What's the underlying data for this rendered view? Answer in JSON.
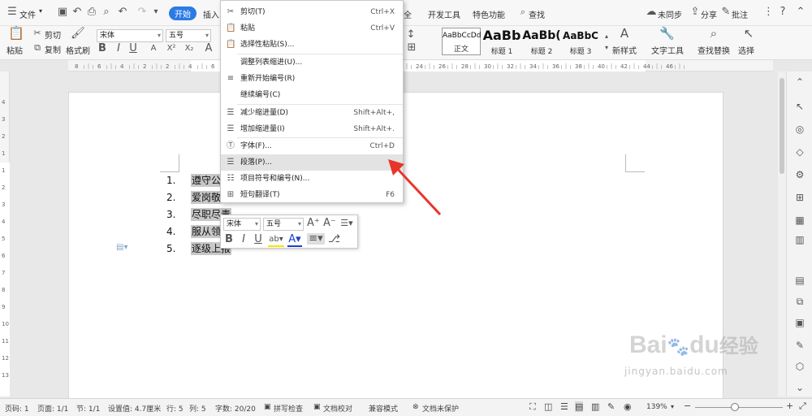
{
  "topbar": {
    "menu_label": "文件",
    "tabs": [
      "开始",
      "插入",
      "全",
      "开发工具",
      "特色功能"
    ],
    "search_label": "查找",
    "sync_label": "未同步",
    "share_label": "分享",
    "comment_label": "批注"
  },
  "ribbon": {
    "paste": "粘贴",
    "cut": "剪切",
    "copy": "复制",
    "format_painter": "格式刷",
    "font_name": "宋体",
    "font_size": "五号",
    "styles": [
      {
        "sample": "AaBbCcDd",
        "name": "正文"
      },
      {
        "sample": "AaBb",
        "name": "标题 1"
      },
      {
        "sample": "AaBb(",
        "name": "标题 2"
      },
      {
        "sample": "AaBbC",
        "name": "标题 3"
      }
    ],
    "new_style": "新样式",
    "text_tools": "文字工具",
    "find_replace": "查找替换",
    "select": "选择"
  },
  "ruler": {
    "h_ticks": [
      "8",
      "6",
      "4",
      "2",
      "2",
      "4",
      "6",
      "8",
      "10",
      "12",
      "14",
      "16",
      "18",
      "20",
      "22",
      "24",
      "26",
      "28",
      "30",
      "32",
      "34",
      "36",
      "38",
      "40",
      "42",
      "44",
      "46"
    ],
    "v_ticks": [
      "4",
      "3",
      "2",
      "1",
      "1",
      "2",
      "3",
      "4",
      "5",
      "6",
      "7",
      "8",
      "9",
      "10",
      "11",
      "12",
      "13"
    ]
  },
  "document": {
    "list": [
      {
        "num": "1.",
        "text": "遵守公"
      },
      {
        "num": "2.",
        "text": "爱岗敬"
      },
      {
        "num": "3.",
        "text": "尽职尽责"
      },
      {
        "num": "4.",
        "text": "服从领"
      },
      {
        "num": "5.",
        "text": "逐级上报"
      }
    ]
  },
  "context_menu": {
    "items": [
      {
        "icon": "✂",
        "label": "剪切(T)",
        "shortcut": "Ctrl+X"
      },
      {
        "icon": "📋",
        "label": "粘贴",
        "shortcut": "Ctrl+V"
      },
      {
        "icon": "📋",
        "label": "选择性粘贴(S)...",
        "shortcut": ""
      },
      {
        "icon": "",
        "label": "调整列表缩进(U)...",
        "shortcut": ""
      },
      {
        "icon": "≡",
        "label": "重新开始编号(R)",
        "shortcut": ""
      },
      {
        "icon": "",
        "label": "继续编号(C)",
        "shortcut": ""
      },
      {
        "icon": "☰",
        "label": "减少缩进量(D)",
        "shortcut": "Shift+Alt+,"
      },
      {
        "icon": "☰",
        "label": "增加缩进量(I)",
        "shortcut": "Shift+Alt+."
      },
      {
        "icon": "Ⓣ",
        "label": "字体(F)...",
        "shortcut": "Ctrl+D"
      },
      {
        "icon": "☰",
        "label": "段落(P)...",
        "shortcut": ""
      },
      {
        "icon": "☷",
        "label": "项目符号和编号(N)...",
        "shortcut": ""
      },
      {
        "icon": "⊞",
        "label": "短句翻译(T)",
        "shortcut": "F6"
      }
    ]
  },
  "minibar": {
    "font_name": "宋体",
    "font_size": "五号"
  },
  "statusbar": {
    "page_num": "页码: 1",
    "pages": "页面: 1/1",
    "section": "节: 1/1",
    "setting": "设置值: 4.7厘米",
    "row": "行: 5",
    "col": "列: 5",
    "word_count": "字数: 20/20",
    "spell_check": "拼写检查",
    "doc_check": "文档校对",
    "compat_mode": "兼容模式",
    "protect": "文档未保护",
    "zoom": "139%"
  },
  "watermark": {
    "brand": "Bai",
    "brand2": "du",
    "cn": "经验",
    "url": "jingyan.baidu.com"
  },
  "colors": {
    "accent": "#2c7be5",
    "arrow": "#e8352b",
    "selection": "#c8c8c8"
  }
}
